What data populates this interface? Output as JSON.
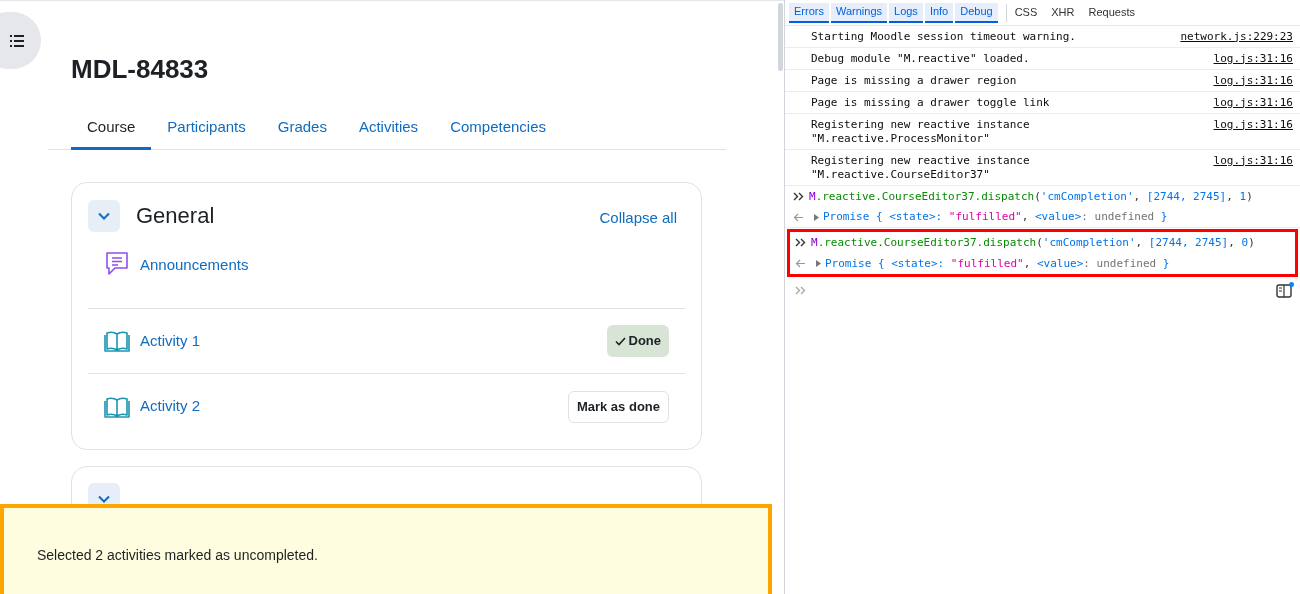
{
  "course": {
    "title": "MDL-84833",
    "tabs": [
      {
        "label": "Course",
        "selected": true
      },
      {
        "label": "Participants",
        "selected": false
      },
      {
        "label": "Grades",
        "selected": false
      },
      {
        "label": "Activities",
        "selected": false
      },
      {
        "label": "Competencies",
        "selected": false
      }
    ],
    "sections": [
      {
        "title": "General",
        "expanded": true,
        "action": "Collapse all",
        "activities": [
          {
            "name": "Announcements",
            "kind": "forum"
          },
          {
            "name": "Activity 1",
            "kind": "book",
            "completion": {
              "label": "Done",
              "done": true
            }
          },
          {
            "name": "Activity 2",
            "kind": "book",
            "completion": {
              "label": "Mark as done",
              "done": false
            }
          }
        ]
      },
      {
        "expanded": true
      }
    ]
  },
  "toast": {
    "message": "Selected 2 activities marked as uncompleted."
  },
  "console": {
    "filters": [
      {
        "label": "Errors",
        "selected": true
      },
      {
        "label": "Warnings",
        "selected": true
      },
      {
        "label": "Logs",
        "selected": true
      },
      {
        "label": "Info",
        "selected": true
      },
      {
        "label": "Debug",
        "selected": true
      }
    ],
    "types": [
      "CSS",
      "XHR",
      "Requests"
    ],
    "entries": [
      {
        "kind": "log",
        "lines": [
          "Starting Moodle session timeout warning."
        ],
        "source": "network.js:229:23"
      },
      {
        "kind": "log",
        "lines": [
          "Debug module \"M.reactive\" loaded."
        ],
        "source": "log.js:31:16"
      },
      {
        "kind": "log",
        "lines": [
          "Page is missing a drawer region"
        ],
        "source": "log.js:31:16"
      },
      {
        "kind": "log",
        "lines": [
          "Page is missing a drawer toggle link"
        ],
        "source": "log.js:31:16"
      },
      {
        "kind": "log",
        "lines": [
          "Registering new reactive instance",
          "\"M.reactive.ProcessMonitor\""
        ],
        "source": "log.js:31:16"
      },
      {
        "kind": "log",
        "lines": [
          "Registering new reactive instance",
          "\"M.reactive.CourseEditor37\""
        ],
        "source": "log.js:31:16"
      },
      {
        "kind": "input",
        "highlighted": false,
        "tokens": [
          {
            "t": "M",
            "kind": "object"
          },
          {
            "t": ".reactive.CourseEditor37.dispatch",
            "kind": "code"
          },
          {
            "t": "(",
            "kind": "punct"
          },
          {
            "t": "'cmCompletion'",
            "kind": "string"
          },
          {
            "t": ", ",
            "kind": "punct"
          },
          {
            "t": "[2744, 2745]",
            "kind": "number"
          },
          {
            "t": ", ",
            "kind": "punct"
          },
          {
            "t": "1",
            "kind": "number"
          },
          {
            "t": ")",
            "kind": "punct"
          }
        ]
      },
      {
        "kind": "result",
        "highlighted": false,
        "tokens": [
          {
            "t": "Promise { <state>: ",
            "kind": "key"
          },
          {
            "t": "\"fulfilled\"",
            "kind": "value"
          },
          {
            "t": ", ",
            "kind": "punct"
          },
          {
            "t": "<value>",
            "kind": "key"
          },
          {
            "t": ": undefined ",
            "kind": "muted"
          },
          {
            "t": "}",
            "kind": "key"
          }
        ]
      },
      {
        "kind": "input",
        "highlighted": true,
        "tokens": [
          {
            "t": "M",
            "kind": "object"
          },
          {
            "t": ".reactive.CourseEditor37.dispatch",
            "kind": "code"
          },
          {
            "t": "(",
            "kind": "punct"
          },
          {
            "t": "'cmCompletion'",
            "kind": "string"
          },
          {
            "t": ", ",
            "kind": "punct"
          },
          {
            "t": "[2744, 2745]",
            "kind": "number"
          },
          {
            "t": ", ",
            "kind": "punct"
          },
          {
            "t": "0",
            "kind": "number"
          },
          {
            "t": ")",
            "kind": "punct"
          }
        ]
      },
      {
        "kind": "result",
        "highlighted": true,
        "tokens": [
          {
            "t": "Promise { <state>: ",
            "kind": "key"
          },
          {
            "t": "\"fulfilled\"",
            "kind": "value"
          },
          {
            "t": ", ",
            "kind": "punct"
          },
          {
            "t": "<value>",
            "kind": "key"
          },
          {
            "t": ": undefined ",
            "kind": "muted"
          },
          {
            "t": "}",
            "kind": "key"
          }
        ]
      }
    ]
  }
}
